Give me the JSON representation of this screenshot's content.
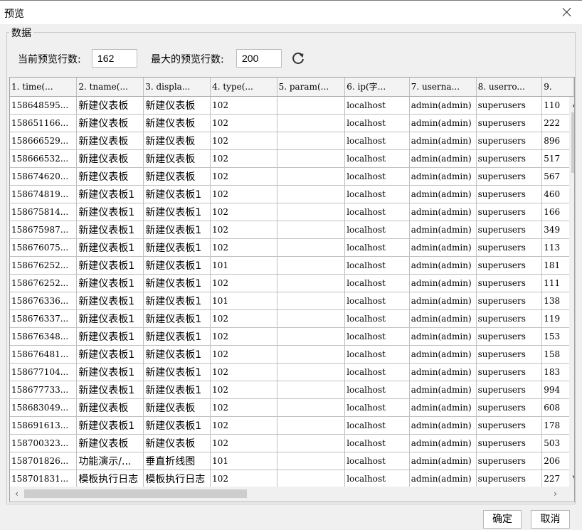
{
  "window": {
    "title": "预览"
  },
  "group": {
    "legend": "数据"
  },
  "controls": {
    "current_rows_label": "当前预览行数:",
    "current_rows_value": "162",
    "max_rows_label": "最大的预览行数:",
    "max_rows_value": "200"
  },
  "table": {
    "columns": [
      "1. time(...",
      "2. tname(...",
      "3. displa...",
      "4. type(...",
      "5. param(...",
      "6. ip(字...",
      "7. userna...",
      "8. userro...",
      "9."
    ],
    "rows": [
      [
        "158648595...",
        "新建仪表板",
        "新建仪表板",
        "102",
        "",
        "localhost",
        "admin(admin)",
        "superusers",
        "110"
      ],
      [
        "158651166...",
        "新建仪表板",
        "新建仪表板",
        "102",
        "",
        "localhost",
        "admin(admin)",
        "superusers",
        "222"
      ],
      [
        "158666529...",
        "新建仪表板",
        "新建仪表板",
        "102",
        "",
        "localhost",
        "admin(admin)",
        "superusers",
        "896"
      ],
      [
        "158666532...",
        "新建仪表板",
        "新建仪表板",
        "102",
        "",
        "localhost",
        "admin(admin)",
        "superusers",
        "517"
      ],
      [
        "158674620...",
        "新建仪表板",
        "新建仪表板",
        "102",
        "",
        "localhost",
        "admin(admin)",
        "superusers",
        "567"
      ],
      [
        "158674819...",
        "新建仪表板1",
        "新建仪表板1",
        "102",
        "",
        "localhost",
        "admin(admin)",
        "superusers",
        "460"
      ],
      [
        "158675814...",
        "新建仪表板1",
        "新建仪表板1",
        "102",
        "",
        "localhost",
        "admin(admin)",
        "superusers",
        "166"
      ],
      [
        "158675987...",
        "新建仪表板1",
        "新建仪表板1",
        "102",
        "",
        "localhost",
        "admin(admin)",
        "superusers",
        "349"
      ],
      [
        "158676075...",
        "新建仪表板1",
        "新建仪表板1",
        "102",
        "",
        "localhost",
        "admin(admin)",
        "superusers",
        "113"
      ],
      [
        "158676252...",
        "新建仪表板1",
        "新建仪表板1",
        "101",
        "",
        "localhost",
        "admin(admin)",
        "superusers",
        "181"
      ],
      [
        "158676252...",
        "新建仪表板1",
        "新建仪表板1",
        "102",
        "",
        "localhost",
        "admin(admin)",
        "superusers",
        "111"
      ],
      [
        "158676336...",
        "新建仪表板1",
        "新建仪表板1",
        "101",
        "",
        "localhost",
        "admin(admin)",
        "superusers",
        "138"
      ],
      [
        "158676337...",
        "新建仪表板1",
        "新建仪表板1",
        "102",
        "",
        "localhost",
        "admin(admin)",
        "superusers",
        "119"
      ],
      [
        "158676348...",
        "新建仪表板1",
        "新建仪表板1",
        "102",
        "",
        "localhost",
        "admin(admin)",
        "superusers",
        "153"
      ],
      [
        "158676481...",
        "新建仪表板1",
        "新建仪表板1",
        "102",
        "",
        "localhost",
        "admin(admin)",
        "superusers",
        "158"
      ],
      [
        "158677104...",
        "新建仪表板1",
        "新建仪表板1",
        "102",
        "",
        "localhost",
        "admin(admin)",
        "superusers",
        "183"
      ],
      [
        "158677733...",
        "新建仪表板1",
        "新建仪表板1",
        "102",
        "",
        "localhost",
        "admin(admin)",
        "superusers",
        "994"
      ],
      [
        "158683049...",
        "新建仪表板",
        "新建仪表板",
        "102",
        "",
        "localhost",
        "admin(admin)",
        "superusers",
        "608"
      ],
      [
        "158691613...",
        "新建仪表板1",
        "新建仪表板1",
        "102",
        "",
        "localhost",
        "admin(admin)",
        "superusers",
        "178"
      ],
      [
        "158700323...",
        "新建仪表板",
        "新建仪表板",
        "102",
        "",
        "localhost",
        "admin(admin)",
        "superusers",
        "503"
      ],
      [
        "158701826...",
        "功能演示/...",
        "垂直折线图",
        "101",
        "",
        "localhost",
        "admin(admin)",
        "superusers",
        "206"
      ],
      [
        "158701831...",
        "模板执行日志",
        "模板执行日志",
        "102",
        "",
        "localhost",
        "admin(admin)",
        "superusers",
        "227"
      ]
    ]
  },
  "buttons": {
    "ok": "确定",
    "cancel": "取消"
  },
  "icons": {
    "close": "close-icon",
    "refresh": "refresh-icon"
  }
}
